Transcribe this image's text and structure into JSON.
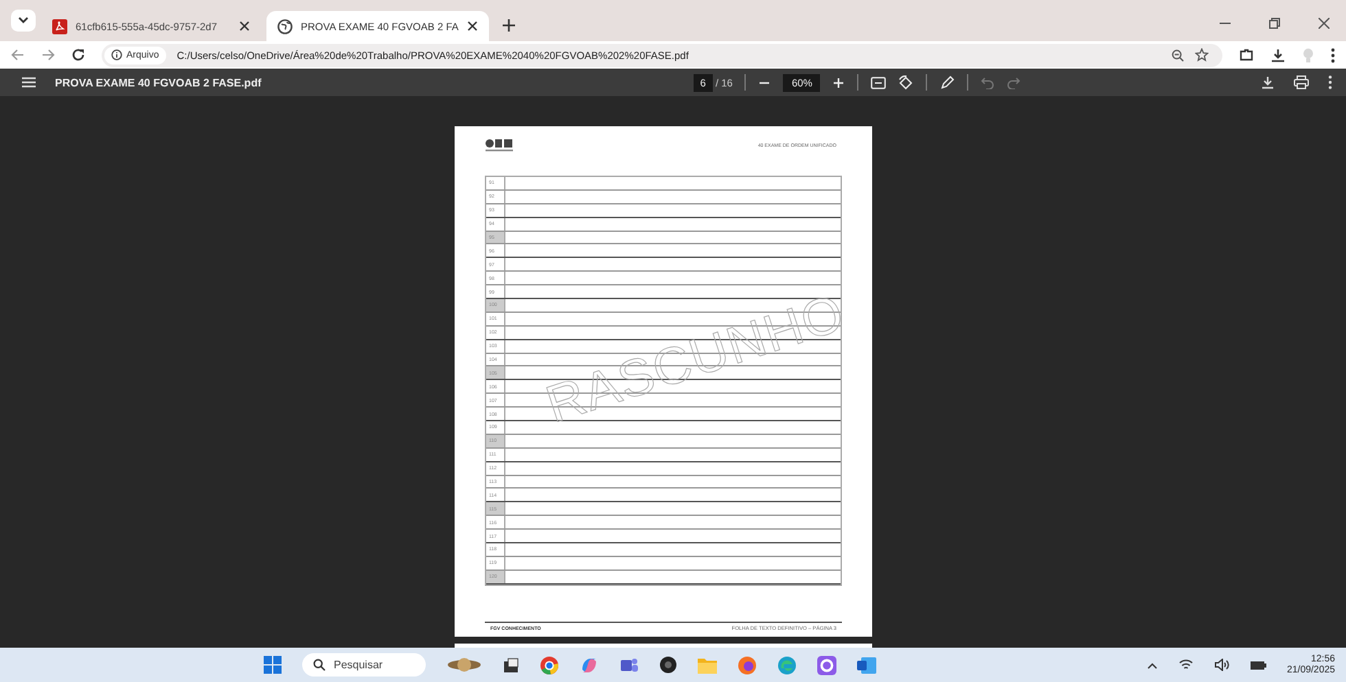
{
  "tabs": [
    {
      "kind": "pdf",
      "label": "61cfb615-555a-45dc-9757-2d7",
      "selected": false
    },
    {
      "kind": "web",
      "label": "PROVA EXAME 40 FGVOAB 2 FA",
      "selected": true
    }
  ],
  "address_bar": {
    "chip": "Arquivo",
    "url": "C:/Users/celso/OneDrive/Área%20de%20Trabalho/PROVA%20EXAME%2040%20FGVOAB%202%20FASE.pdf"
  },
  "pdf_toolbar": {
    "filename": "PROVA EXAME 40 FGVOAB 2 FASE.pdf",
    "page": "6",
    "page_total": "/ 16",
    "zoom": "60%"
  },
  "page": {
    "header": "40 EXAME DE ORDEM UNIFICADO",
    "watermark": "RASCUNHO",
    "footer_left": "FGV CONHECIMENTO",
    "footer_right": "FOLHA DE TEXTO DEFINITIVO – PÁGINA 3",
    "lines": [
      {
        "number": "91",
        "shaded": false
      },
      {
        "number": "92",
        "shaded": false
      },
      {
        "number": "93",
        "shaded": false
      },
      {
        "number": "94",
        "shaded": false
      },
      {
        "number": "95",
        "shaded": true
      },
      {
        "number": "96",
        "shaded": false
      },
      {
        "number": "97",
        "shaded": false
      },
      {
        "number": "98",
        "shaded": false
      },
      {
        "number": "99",
        "shaded": false
      },
      {
        "number": "100",
        "shaded": true
      },
      {
        "number": "101",
        "shaded": false
      },
      {
        "number": "102",
        "shaded": false
      },
      {
        "number": "103",
        "shaded": false
      },
      {
        "number": "104",
        "shaded": false
      },
      {
        "number": "105",
        "shaded": true
      },
      {
        "number": "106",
        "shaded": false
      },
      {
        "number": "107",
        "shaded": false
      },
      {
        "number": "108",
        "shaded": false
      },
      {
        "number": "109",
        "shaded": false
      },
      {
        "number": "110",
        "shaded": true
      },
      {
        "number": "111",
        "shaded": false
      },
      {
        "number": "112",
        "shaded": false
      },
      {
        "number": "113",
        "shaded": false
      },
      {
        "number": "114",
        "shaded": false
      },
      {
        "number": "115",
        "shaded": true
      },
      {
        "number": "116",
        "shaded": false
      },
      {
        "number": "117",
        "shaded": false
      },
      {
        "number": "118",
        "shaded": false
      },
      {
        "number": "119",
        "shaded": false
      },
      {
        "number": "120",
        "shaded": true
      }
    ]
  },
  "taskbar": {
    "search_placeholder": "Pesquisar",
    "time": "12:56",
    "date": "21/09/2025"
  }
}
